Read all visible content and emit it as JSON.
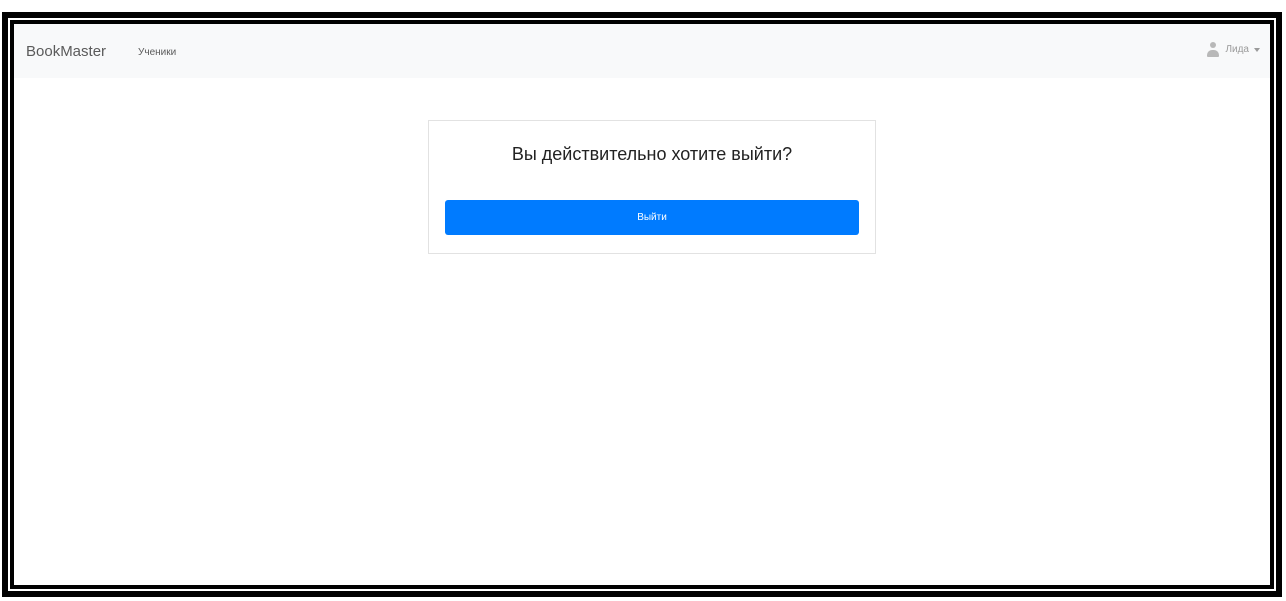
{
  "navbar": {
    "brand": "BookMaster",
    "links": [
      {
        "label": "Ученики"
      }
    ],
    "user": {
      "name": "Лида",
      "icon": "user-icon"
    }
  },
  "logout_dialog": {
    "question": "Вы действительно хотите выйти?",
    "button_label": "Выйти"
  },
  "colors": {
    "primary": "#007bff",
    "navbar_bg": "#f8f9fa",
    "frame": "#000000"
  }
}
